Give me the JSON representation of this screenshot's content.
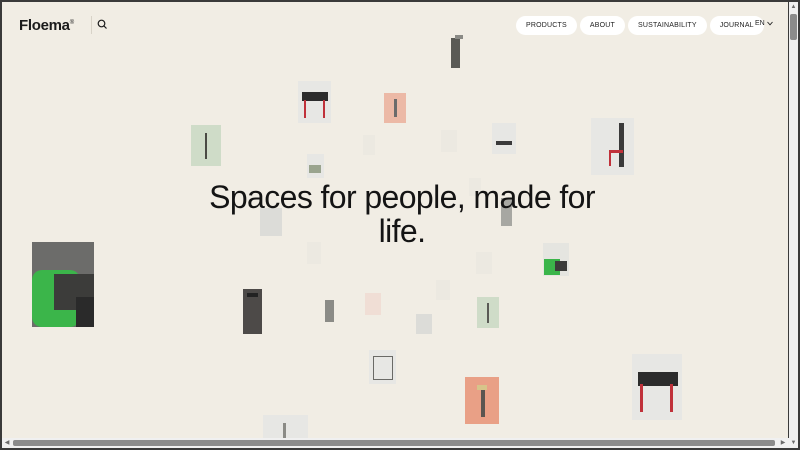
{
  "brand": {
    "logo": "Floema",
    "logo_mark": "®"
  },
  "nav": {
    "items": [
      "PRODUCTS",
      "ABOUT",
      "SUSTAINABILITY",
      "JOURNAL"
    ]
  },
  "language": "EN",
  "hero": {
    "headline": "Spaces for people, made for life."
  },
  "colors": {
    "background": "#f1ede4",
    "text": "#141414",
    "pill": "#ffffff",
    "accent_red": "#c0313a",
    "accent_green": "#3bb54a"
  },
  "icons": [
    "search-icon",
    "chevron-down-icon",
    "scroll-up-arrow-icon",
    "scroll-down-arrow-icon",
    "scroll-left-arrow-icon",
    "scroll-right-arrow-icon"
  ]
}
